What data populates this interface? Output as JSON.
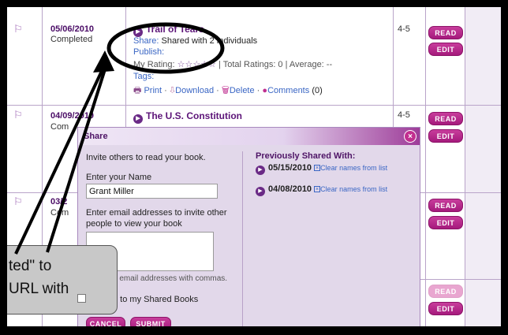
{
  "rows": [
    {
      "date": "05/06/2010",
      "status": "Completed",
      "grade": "4-5",
      "title": "Trail of Tears",
      "share_label": "Share:",
      "share_value": "Shared with 2 individuals",
      "publish_label": "Publish:",
      "rating_label": "My Rating:",
      "stars": "☆☆☆☆☆",
      "total_ratings": "| Total Ratings: 0 | Average: --",
      "tags_label": "Tags:",
      "actions": {
        "print": "Print",
        "download": "Download",
        "delete": "Delete",
        "comments": "Comments",
        "comments_count": "(0)"
      },
      "read_label": "Read",
      "edit_label": "Edit"
    },
    {
      "date": "04/09/2010",
      "status": "Com",
      "grade": "4-5",
      "title": "The U.S. Constitution",
      "read_label": "Read",
      "edit_label": "Edit"
    },
    {
      "date": "03/2",
      "status": "Com",
      "read_label": "Read",
      "edit_label": "Edit"
    },
    {
      "read_label": "Read",
      "edit_label": "Edit"
    }
  ],
  "dialog": {
    "title": "Share",
    "close": "×",
    "invite_text": "Invite others to read your book.",
    "name_label": "Enter your Name",
    "name_value": "Grant Miller",
    "email_label_1": "Enter email addresses to invite other",
    "email_label_2": "people to view your book",
    "email_hint": "e email addresses with commas.",
    "add_label": "d to my Shared Books",
    "cancel_label": "Cancel",
    "submit_label": "Submit",
    "prev_title": "Previously Shared With:",
    "prev_items": [
      {
        "date": "05/15/2010",
        "clear": "Clear names from list"
      },
      {
        "date": "04/08/2010",
        "clear": "Clear names from list"
      }
    ]
  },
  "callout": {
    "line1": "ted\" to",
    "line2": "URL with"
  },
  "colors": {
    "accent": "#5c1478",
    "button": "#b0237f",
    "link": "#3a66c4",
    "dialog_bg": "#e2d8ea"
  }
}
